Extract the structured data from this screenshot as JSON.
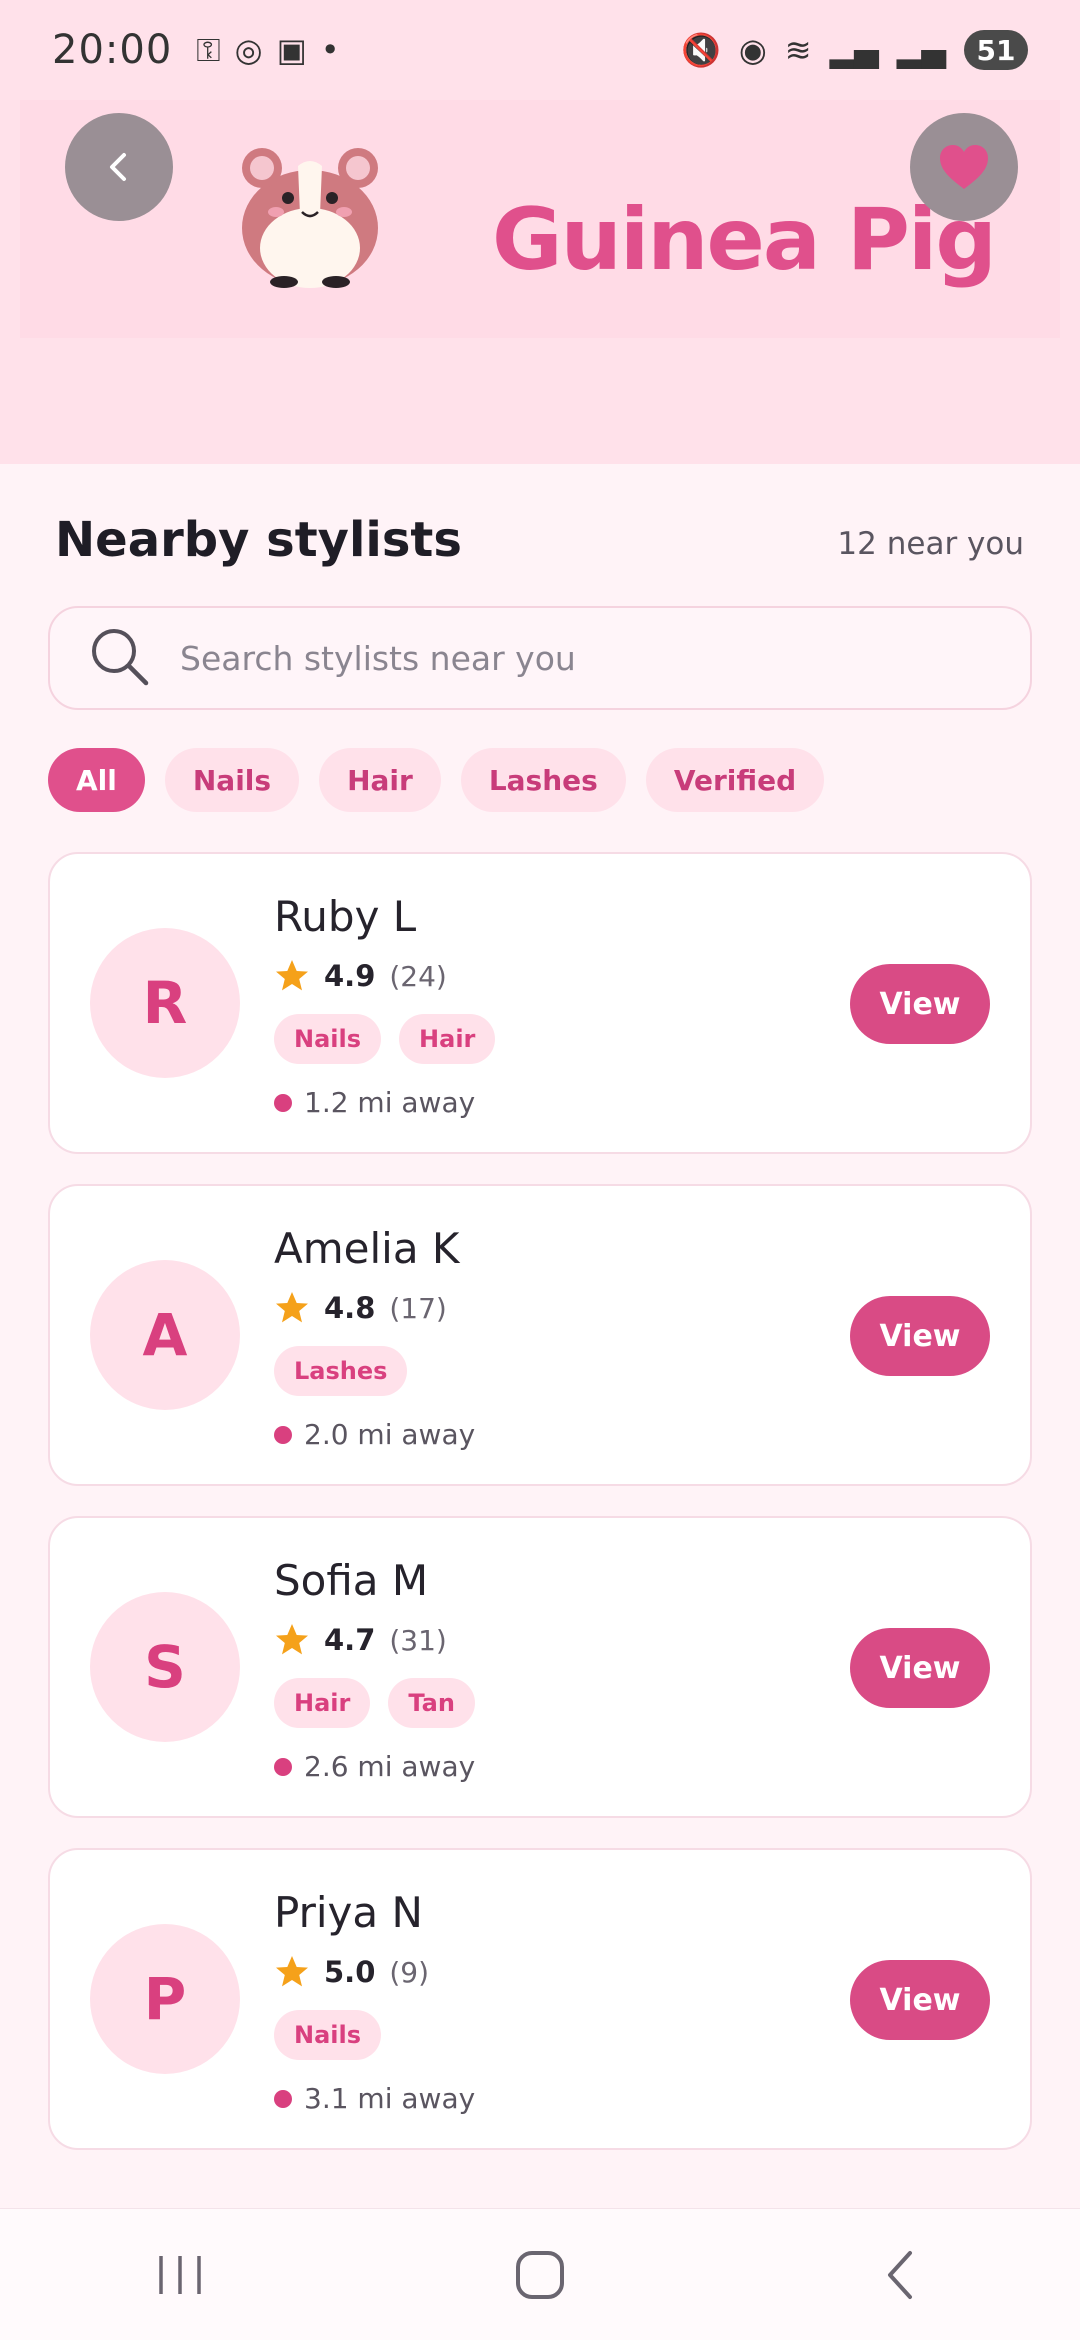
{
  "status_bar": {
    "time": "20:00",
    "battery": "51"
  },
  "header": {
    "brand": "Guinea Pig"
  },
  "section": {
    "title": "Nearby stylists",
    "count": "12 near you"
  },
  "search": {
    "placeholder": "Search stylists near you"
  },
  "filters": [
    {
      "label": "All",
      "active": true
    },
    {
      "label": "Nails",
      "active": false
    },
    {
      "label": "Hair",
      "active": false
    },
    {
      "label": "Lashes",
      "active": false
    },
    {
      "label": "Verified",
      "active": false
    }
  ],
  "stylists": [
    {
      "initial": "R",
      "name": "Ruby L",
      "rating": "4.9",
      "reviews": "(24)",
      "tags": [
        "Nails",
        "Hair"
      ],
      "distance": "1.2 mi away",
      "action": "View"
    },
    {
      "initial": "A",
      "name": "Amelia K",
      "rating": "4.8",
      "reviews": "(17)",
      "tags": [
        "Lashes"
      ],
      "distance": "2.0 mi away",
      "action": "View"
    },
    {
      "initial": "S",
      "name": "Sofia M",
      "rating": "4.7",
      "reviews": "(31)",
      "tags": [
        "Hair",
        "Tan"
      ],
      "distance": "2.6 mi away",
      "action": "View"
    },
    {
      "initial": "P",
      "name": "Priya N",
      "rating": "5.0",
      "reviews": "(9)",
      "tags": [
        "Nails"
      ],
      "distance": "3.1 mi away",
      "action": "View"
    }
  ],
  "colors": {
    "accent": "#e0508c",
    "button": "#d94b85",
    "header_bg": "#ffe1ea",
    "page_bg": "#fff3f7",
    "star": "#f5a11a"
  },
  "icons": {
    "back": "chevron-left-icon",
    "favorite": "heart-icon",
    "search": "search-icon",
    "rating": "star-icon",
    "nav_recents": "recents-icon",
    "nav_home": "home-icon",
    "nav_back": "back-icon"
  }
}
